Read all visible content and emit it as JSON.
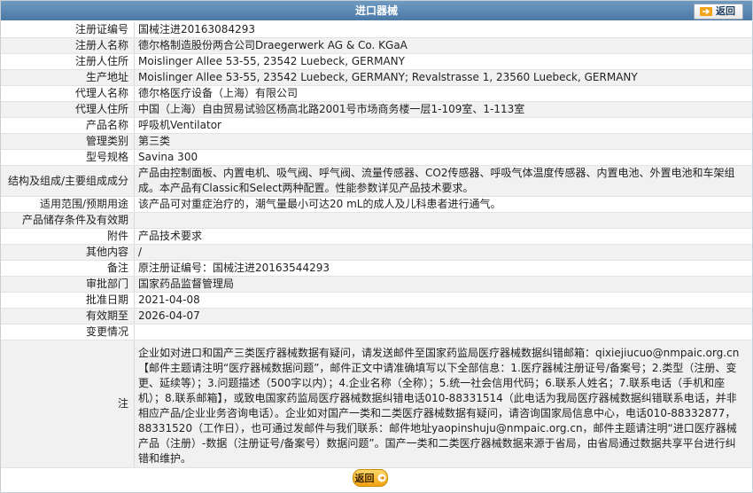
{
  "header": {
    "title": "进口器械",
    "back_button_label": "返回",
    "arrow_icon": "arrow-right-icon",
    "accent": "#5a86b3"
  },
  "fields": [
    {
      "label": "注册证编号",
      "value": "国械注进20163084293"
    },
    {
      "label": "注册人名称",
      "value": "德尔格制造股份两合公司Draegerwerk AG & Co. KGaA"
    },
    {
      "label": "注册人住所",
      "value": "Moislinger Allee 53-55, 23542 Luebeck, GERMANY"
    },
    {
      "label": "生产地址",
      "value": "Moislinger Allee 53-55, 23542 Luebeck, GERMANY; Revalstrasse 1, 23560 Luebeck, GERMANY"
    },
    {
      "label": "代理人名称",
      "value": "德尔格医疗设备（上海）有限公司"
    },
    {
      "label": "代理人住所",
      "value": "中国（上海）自由贸易试验区杨高北路2001号市场商务楼一层1-109室、1-113室"
    },
    {
      "label": "产品名称",
      "value": "呼吸机Ventilator"
    },
    {
      "label": "管理类别",
      "value": "第三类"
    },
    {
      "label": "型号规格",
      "value": "Savina 300"
    },
    {
      "label": "结构及组成/主要组成成分",
      "value": "产品由控制面板、内置电机、吸气阀、呼气阀、流量传感器、CO2传感器、呼吸气体温度传感器、内置电池、外置电池和车架组成。本产品有Classic和Select两种配置。性能参数详见产品技术要求。"
    },
    {
      "label": "适用范围/预期用途",
      "value": "该产品可对重症治疗的，潮气量最小可达20 mL的成人及儿科患者进行通气。"
    },
    {
      "label": "产品储存条件及有效期",
      "value": ""
    },
    {
      "label": "附件",
      "value": "产品技术要求"
    },
    {
      "label": "其他内容",
      "value": "/"
    },
    {
      "label": "备注",
      "value": "原注册证编号：国械注进20163544293"
    },
    {
      "label": "审批部门",
      "value": "国家药品监督管理局"
    },
    {
      "label": "批准日期",
      "value": "2021-04-08"
    },
    {
      "label": "有效期至",
      "value": "2026-04-07"
    },
    {
      "label": "变更情况",
      "value": ""
    }
  ],
  "note": {
    "label": "注",
    "text": "企业如对进口和国产三类医疗器械数据有疑问，请发送邮件至国家药监局医疗器械数据纠错邮箱：qixiejiucuo@nmpaic.org.cn【邮件主题请注明“医疗器械数据问题”，邮件正文中请准确填写以下全部信息：1.医疗器械注册证号/备案号；2.类型（注册、变更、延续等）；3.问题描述（500字以内）；4.企业名称（全称）；5.统一社会信用代码；6.联系人姓名；7.联系电话（手机和座机）；8.联系邮箱】，或致电国家药监局医疗器械数据纠错电话010-88331514（此电话为我局医疗器械数据纠错联系电话，并非相应产品/企业业务咨询电话）。企业如对国产一类和二类医疗器械数据有疑问，请咨询国家局信息中心，电话010-88332877，88331520（工作日），也可通过发邮件与我们联系：邮件地址yaopinshuju@nmpaic.org.cn，邮件主题请注明“进口医疗器械产品（注册）-数据（注册证号/备案号）数据问题”。国产一类和二类医疗器械数据来源于省局，由省局通过数据共享平台进行纠错和维护。"
  },
  "footer": {
    "back_button_label": "返回",
    "button_color": "#f3b228"
  }
}
